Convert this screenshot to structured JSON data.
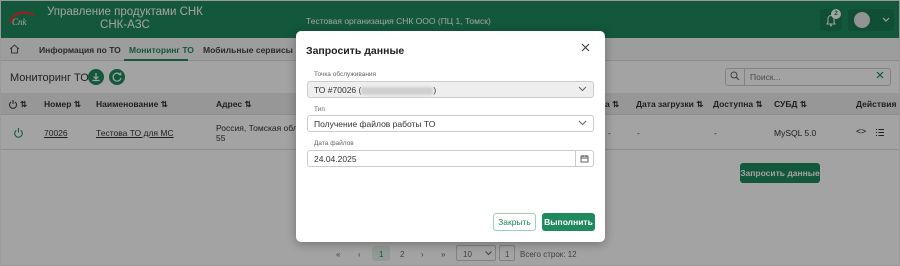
{
  "header": {
    "brand_line1": "Управление продуктами СНК",
    "brand_line2": "СНК-АЗС",
    "organization": "Тестовая организация СНК ООО (ПЦ 1, Томск)",
    "notifications_count": "2",
    "logo_text": "Cnk"
  },
  "tabs": [
    {
      "label": "Информация по ТО"
    },
    {
      "label": "Мониторинг ТО"
    },
    {
      "label": "Мобильные сервисы"
    }
  ],
  "page": {
    "title": "Мониторинг ТО",
    "search_placeholder": "Поиск...",
    "request_button": "Запросить данные"
  },
  "table": {
    "columns": [
      "Номер",
      "Наименование",
      "Адрес",
      "Дата загрузки",
      "Доступна",
      "СУБД",
      "Действия"
    ],
    "partial_column_suffix": "а",
    "rows": [
      {
        "number": "70026",
        "name": "Тестова ТО для МС",
        "address_line1": "Россия, Томская облас",
        "address_line2": "55",
        "date_loaded": "-",
        "available": "-",
        "db": "MySQL 5.0",
        "extra": "-"
      }
    ]
  },
  "pagination": {
    "first": "«",
    "prev": "‹",
    "page1": "1",
    "page2": "2",
    "next": "›",
    "last": "»",
    "page_size": "10",
    "goto_page": "1",
    "total": "Всего строк: 12"
  },
  "modal": {
    "title": "Запросить данные",
    "point_label": "Точка обслуживания",
    "point_value": "ТО #70026 (",
    "point_value_end": ")",
    "type_label": "Тип",
    "type_value": "Получение файлов работы ТО",
    "date_label": "Дата файлов",
    "date_value": "24.04.2025",
    "close_button": "Закрыть",
    "run_button": "Выполнить"
  },
  "colors": {
    "primary": "#1e8a5e",
    "header_bg": "#1e8a5e"
  },
  "icons": [
    "home-icon",
    "download-icon",
    "refresh-icon",
    "search-icon",
    "clear-icon",
    "bell-icon",
    "avatar",
    "chevron-down-icon",
    "power-icon",
    "sort-icon",
    "code-icon",
    "list-icon",
    "close-icon",
    "calendar-icon"
  ]
}
